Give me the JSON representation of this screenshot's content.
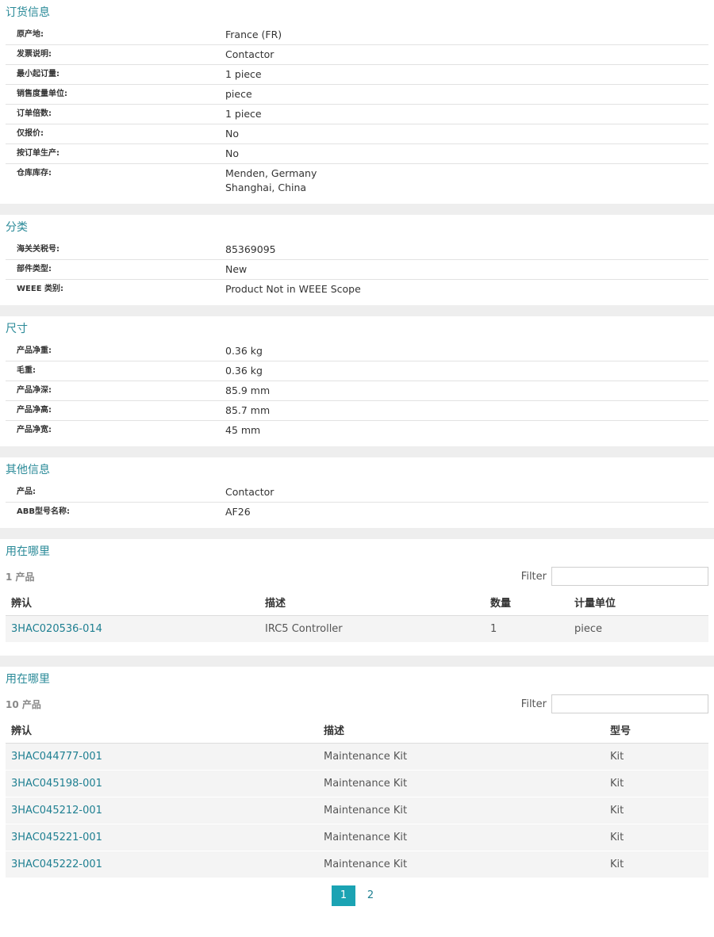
{
  "sections": [
    {
      "title": "订货信息",
      "rows": [
        {
          "key": "原产地:",
          "values": [
            "France (FR)"
          ]
        },
        {
          "key": "发票说明:",
          "values": [
            "Contactor"
          ]
        },
        {
          "key": "最小起订量:",
          "values": [
            "1 piece"
          ]
        },
        {
          "key": "销售度量单位:",
          "values": [
            "piece"
          ]
        },
        {
          "key": "订单倍数:",
          "values": [
            "1 piece"
          ]
        },
        {
          "key": "仅报价:",
          "values": [
            "No"
          ]
        },
        {
          "key": "按订单生产:",
          "values": [
            "No"
          ]
        },
        {
          "key": "仓库库存:",
          "values": [
            "Menden, Germany",
            "Shanghai, China"
          ]
        }
      ]
    },
    {
      "title": "分类",
      "rows": [
        {
          "key": "海关关税号:",
          "values": [
            "85369095"
          ]
        },
        {
          "key": "部件类型:",
          "values": [
            "New"
          ]
        },
        {
          "key": "WEEE 类别:",
          "values": [
            "Product Not in WEEE Scope"
          ]
        }
      ]
    },
    {
      "title": "尺寸",
      "rows": [
        {
          "key": "产品净重:",
          "values": [
            "0.36 kg"
          ]
        },
        {
          "key": "毛重:",
          "values": [
            "0.36 kg"
          ]
        },
        {
          "key": "产品净深:",
          "values": [
            "85.9 mm"
          ]
        },
        {
          "key": "产品净高:",
          "values": [
            "85.7 mm"
          ]
        },
        {
          "key": "产品净宽:",
          "values": [
            "45 mm"
          ]
        }
      ]
    },
    {
      "title": "其他信息",
      "rows": [
        {
          "key": "产品:",
          "values": [
            "Contactor"
          ]
        },
        {
          "key": "ABB型号名称:",
          "values": [
            "AF26"
          ]
        }
      ]
    }
  ],
  "used_in_1": {
    "title": "用在哪里",
    "count": "1 产品",
    "filter_label": "Filter",
    "columns": [
      "辨认",
      "描述",
      "数量",
      "计量单位"
    ],
    "rows": [
      [
        "3HAC020536-014",
        "IRC5 Controller",
        "1",
        "piece"
      ]
    ]
  },
  "used_in_2": {
    "title": "用在哪里",
    "count": "10 产品",
    "filter_label": "Filter",
    "columns": [
      "辨认",
      "描述",
      "型号"
    ],
    "rows": [
      [
        "3HAC044777-001",
        "Maintenance Kit",
        "Kit"
      ],
      [
        "3HAC045198-001",
        "Maintenance Kit",
        "Kit"
      ],
      [
        "3HAC045212-001",
        "Maintenance Kit",
        "Kit"
      ],
      [
        "3HAC045221-001",
        "Maintenance Kit",
        "Kit"
      ],
      [
        "3HAC045222-001",
        "Maintenance Kit",
        "Kit"
      ]
    ],
    "pages": [
      "1",
      "2"
    ],
    "active_page": "1"
  },
  "colors": {
    "accent": "#1ba3b3",
    "link": "#1e7f91",
    "title": "#2a8a98"
  }
}
